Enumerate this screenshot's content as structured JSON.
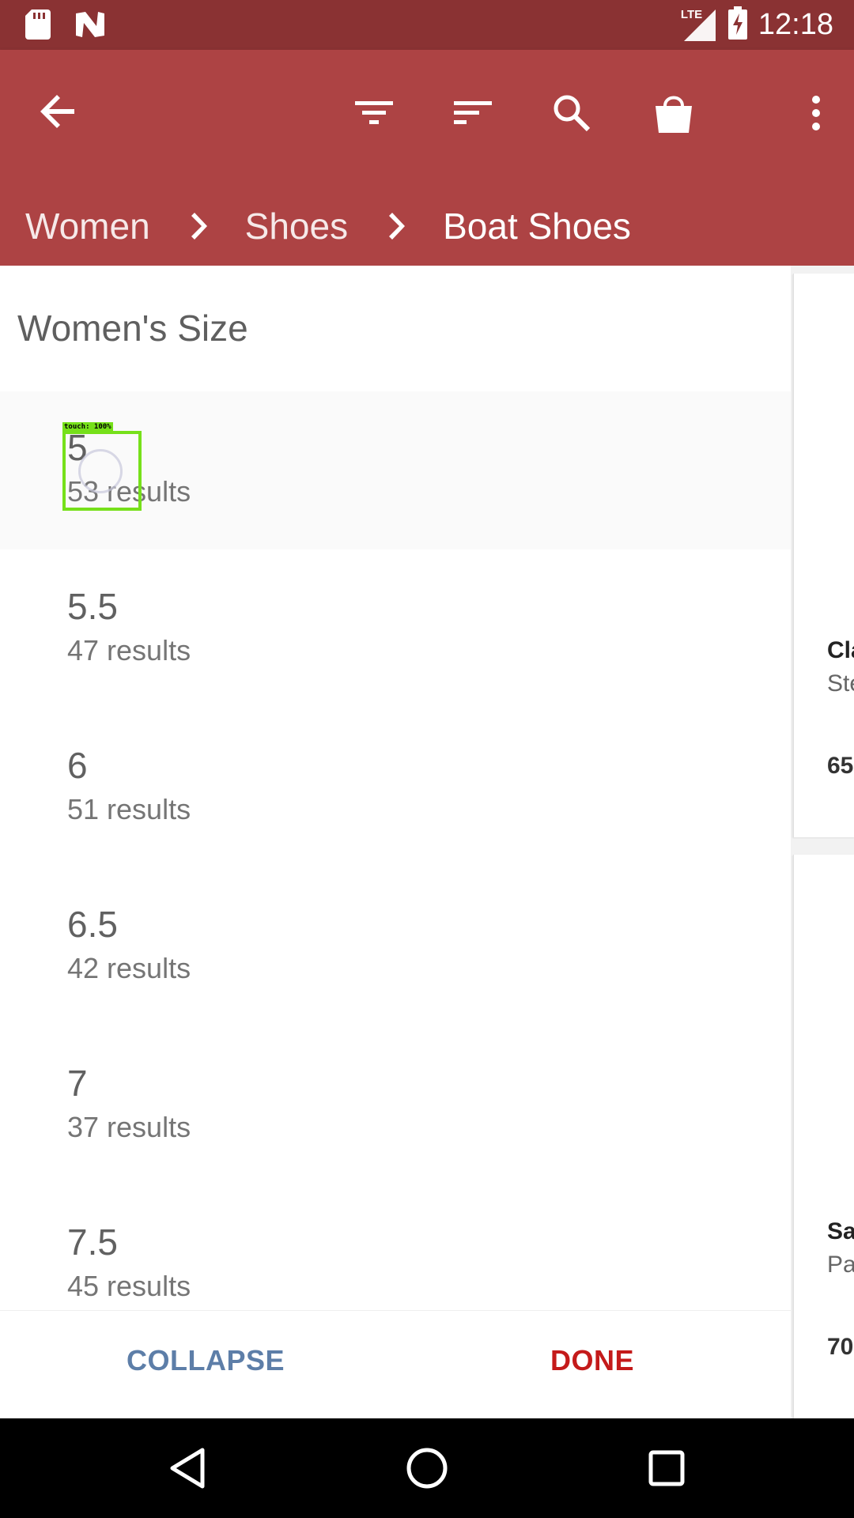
{
  "status_bar": {
    "time": "12:18",
    "network": "LTE",
    "icons": [
      "sd-card-icon",
      "n-notification-icon",
      "signal-icon",
      "battery-charging-icon"
    ]
  },
  "app_bar": {
    "back_icon": "arrow-left-icon",
    "actions": [
      "filter-icon",
      "sort-icon",
      "search-icon",
      "shopping-bag-icon",
      "more-vert-icon"
    ],
    "breadcrumb": [
      "Women",
      "Shoes",
      "Boat Shoes"
    ]
  },
  "filter_panel": {
    "title": "Women's Size",
    "options": [
      {
        "size": "5",
        "count": "53 results"
      },
      {
        "size": "5.5",
        "count": "47 results"
      },
      {
        "size": "6",
        "count": "51 results"
      },
      {
        "size": "6.5",
        "count": "42 results"
      },
      {
        "size": "7",
        "count": "37 results"
      },
      {
        "size": "7.5",
        "count": "45 results"
      }
    ],
    "collapse_label": "COLLAPSE",
    "done_label": "DONE"
  },
  "background_products": [
    {
      "name": "Cla",
      "brand": "Ste",
      "price": "65"
    },
    {
      "name": "Sa",
      "brand": "Pa",
      "price": "70"
    }
  ],
  "touch_overlay": {
    "label": "touch: 100%"
  },
  "colors": {
    "status_bar": "#8a3233",
    "app_bar": "#ad4344",
    "collapse": "#5d7ea8",
    "done": "#c41a1a",
    "touch": "#76e01a"
  },
  "nav_bar": [
    "back-triangle-icon",
    "home-circle-icon",
    "recents-square-icon"
  ]
}
